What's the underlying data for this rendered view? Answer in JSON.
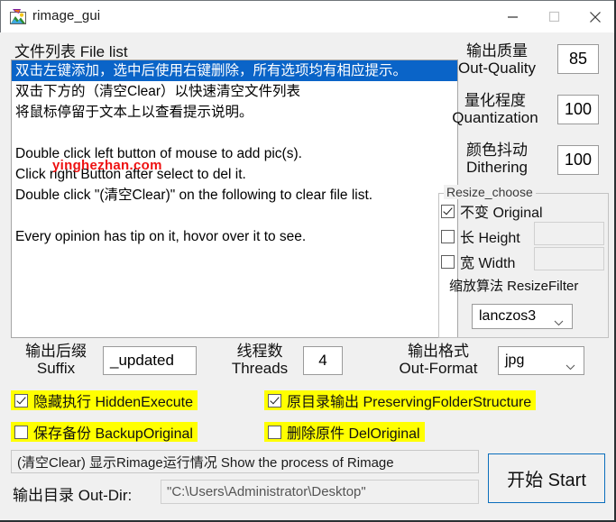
{
  "window": {
    "title": "rimage_gui",
    "icon": "image-picture-icon",
    "minimize_label": "–",
    "maximize_label": "□",
    "close_label": "✕"
  },
  "file_list": {
    "label": "文件列表 File list",
    "rows": [
      {
        "text": "双击左键添加，选中后使用右键删除，所有选项均有相应提示。",
        "selected": true
      },
      {
        "text": "双击下方的（清空Clear）以快速清空文件列表",
        "selected": false
      },
      {
        "text": "将鼠标停留于文本上以查看提示说明。",
        "selected": false
      },
      {
        "text": "",
        "selected": false
      },
      {
        "text": "Double click left button of mouse to add pic(s).",
        "selected": false
      },
      {
        "text": "Click right Button after select to del it.",
        "selected": false
      },
      {
        "text": "Double click \"(清空Clear)\" on the following to clear file list.",
        "selected": false
      },
      {
        "text": "",
        "selected": false
      },
      {
        "text": "Every opinion has tip on it, hovor over it to see.",
        "selected": false
      }
    ]
  },
  "watermark": {
    "text": "yinghezhan.com",
    "color": "#ee1111"
  },
  "settings": {
    "quality": {
      "label_cn": "输出质量",
      "label_en": "Out-Quality",
      "value": "85"
    },
    "quantization": {
      "label_cn": "量化程度",
      "label_en": "Quantization",
      "value": "100"
    },
    "dithering": {
      "label_cn": "颜色抖动",
      "label_en": "Dithering",
      "value": "100"
    }
  },
  "resize_group": {
    "title": "Resize_choose",
    "original": {
      "label": "不变 Original",
      "checked": true
    },
    "height": {
      "label": "长 Height",
      "checked": false,
      "value": ""
    },
    "width": {
      "label": "宽 Width",
      "checked": false,
      "value": ""
    },
    "filter_label": "缩放算法 ResizeFilter",
    "filter_value": "lanczos3"
  },
  "output_row": {
    "suffix": {
      "label_cn": "输出后缀",
      "label_en": "Suffix",
      "value": "_updated"
    },
    "threads": {
      "label_cn": "线程数",
      "label_en": "Threads",
      "value": "4"
    },
    "format": {
      "label_cn": "输出格式",
      "label_en": "Out-Format",
      "value": "jpg"
    }
  },
  "options": {
    "hidden_execute": {
      "label": "隐藏执行 HiddenExecute",
      "checked": true
    },
    "preserving_folder": {
      "label": "原目录输出 PreservingFolderStructure",
      "checked": true
    },
    "backup_original": {
      "label": "保存备份 BackupOriginal",
      "checked": false
    },
    "del_original": {
      "label": "删除原件 DelOriginal",
      "checked": false
    },
    "highlight_color": "#ffff00"
  },
  "bottom": {
    "status_text": "(清空Clear) 显示Rimage运行情况 Show the process of Rimage",
    "outdir_label": "输出目录 Out-Dir:",
    "outdir_value": "\"C:\\Users\\Administrator\\Desktop\"",
    "start_label": "开始 Start"
  }
}
